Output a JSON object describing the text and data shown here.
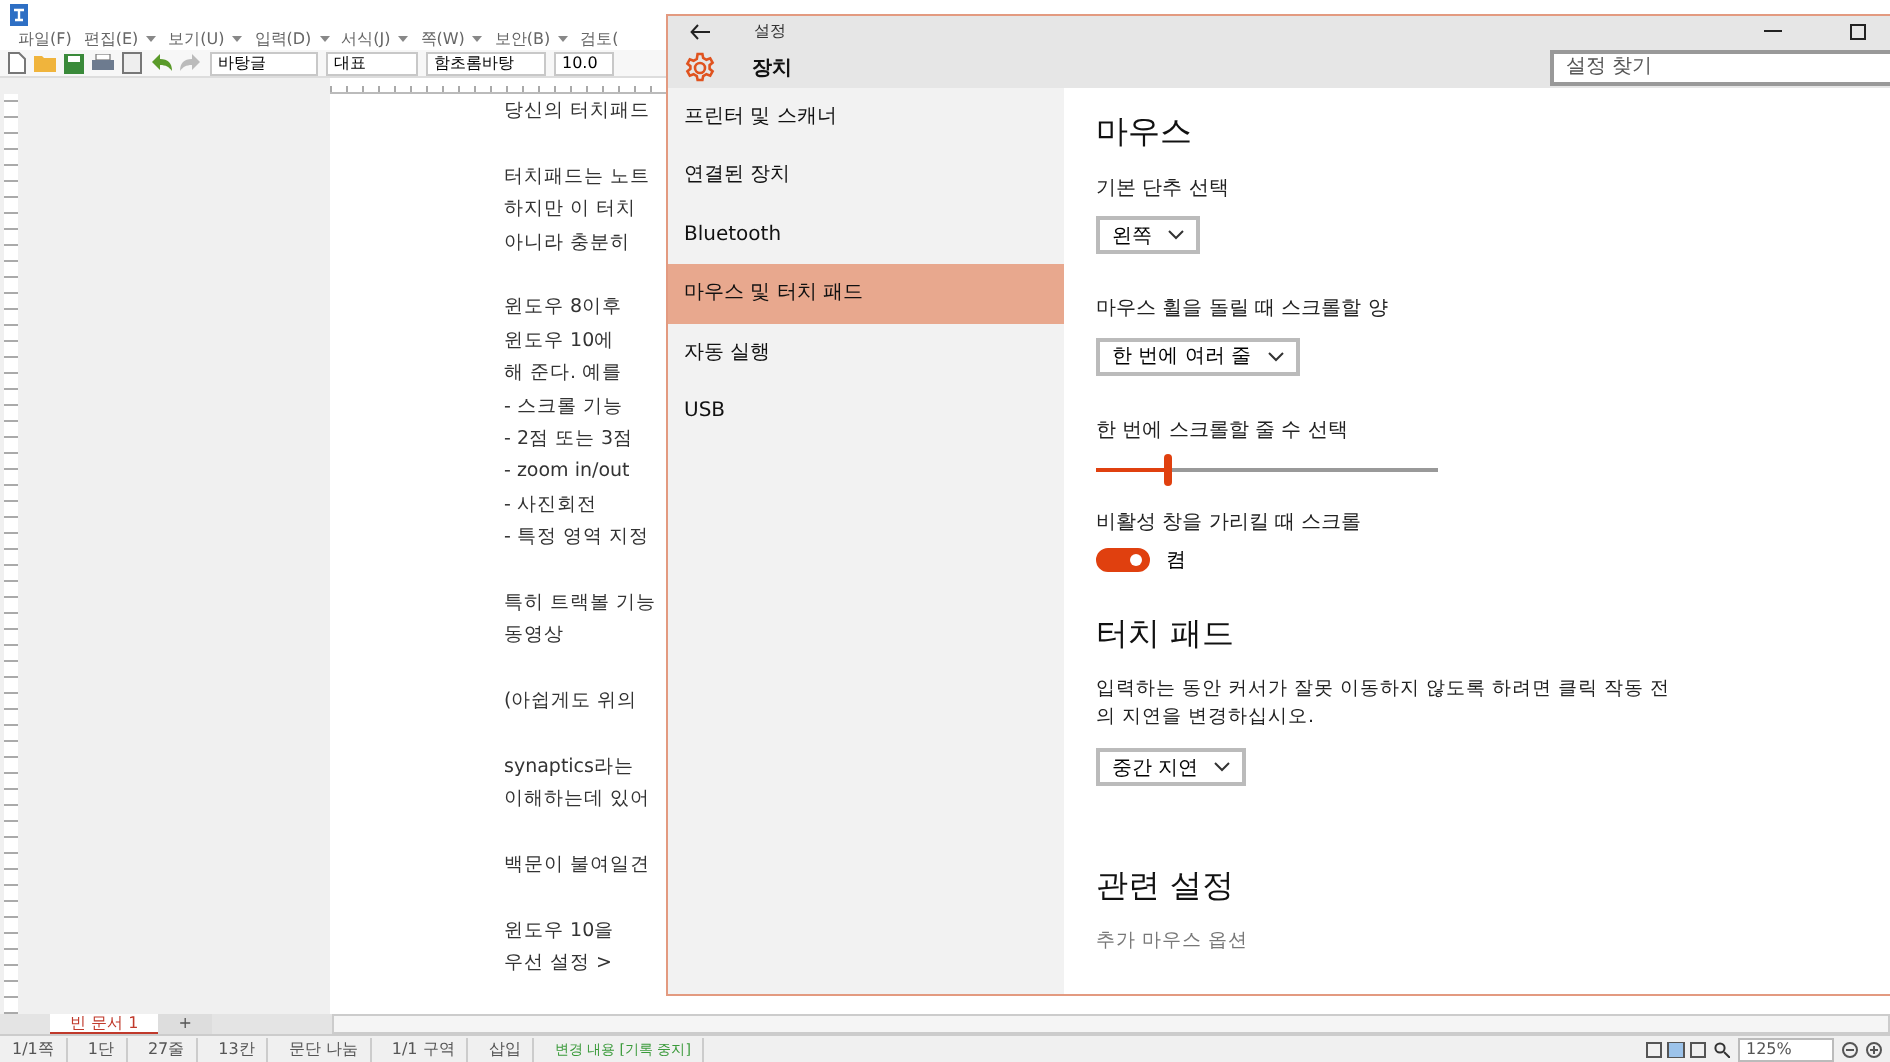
{
  "editor": {
    "menu": [
      "파일(F)",
      "편집(E)",
      "보기(U)",
      "입력(D)",
      "서식(J)",
      "쪽(W)",
      "보안(B)",
      "검토("
    ],
    "toolbar": {
      "style": "바탕글",
      "outline": "대표",
      "font": "함초롬바탕",
      "size": "10.0"
    },
    "paragraphs": [
      [
        "당신의 터치패드"
      ],
      [
        "터치패드는 노트",
        "하지만 이 터치",
        "아니라 충분히"
      ],
      [
        "윈도우 8이후",
        "윈도우 10에",
        "해 준다. 예를",
        "- 스크롤 기능",
        "- 2점 또는 3점",
        "- zoom in/out",
        "- 사진회전",
        "- 특정 영역 지정"
      ],
      [
        "특히 트랙볼 기능",
        "동영상"
      ],
      [
        "(아쉽게도 위의"
      ],
      [
        "synaptics라는",
        "이해하는데 있어"
      ],
      [
        "백문이 불여일견"
      ],
      [
        "윈도우 10을",
        "우선 설정 >"
      ]
    ],
    "doc_tabs": [
      {
        "label": "빈 문서 1",
        "selected": true
      },
      {
        "label": "+",
        "selected": false
      }
    ],
    "status_bar": [
      "1/1쪽",
      "1단",
      "27줄",
      "13칸",
      "문단 나눔",
      "1/1 구역",
      "삽입"
    ],
    "track_changes": "변경 내용 [기록 중지]",
    "zoom": "125%"
  },
  "settings": {
    "window_title": "설정",
    "header": "장치",
    "search": {
      "placeholder": "설정 찾기"
    },
    "sidebar": [
      {
        "label": "프린터 및 스캐너",
        "selected": false
      },
      {
        "label": "연결된 장치",
        "selected": false
      },
      {
        "label": "Bluetooth",
        "selected": false
      },
      {
        "label": "마우스 및 터치 패드",
        "selected": true
      },
      {
        "label": "자동 실행",
        "selected": false
      },
      {
        "label": "USB",
        "selected": false
      }
    ],
    "sections": [
      {
        "title": "마우스",
        "items": [
          {
            "kind": "dropdown",
            "label": "기본 단추 선택",
            "value": "왼쪽"
          },
          {
            "kind": "dropdown",
            "label": "마우스 휠을 돌릴 때 스크롤할 양",
            "value": "한 번에 여러 줄"
          },
          {
            "kind": "slider",
            "label": "한 번에 스크롤할 줄 수 선택",
            "level": 0.21
          },
          {
            "kind": "toggle",
            "label": "비활성 창을 가리킬 때 스크롤",
            "on": true,
            "state": "켬"
          }
        ]
      },
      {
        "title": "터치 패드",
        "items": [
          {
            "kind": "text",
            "label": "입력하는 동안 커서가 잘못 이동하지 않도록 하려면 클릭 작동 전의 지연을 변경하십시오."
          },
          {
            "kind": "dropdown",
            "value": "중간 지연"
          }
        ]
      },
      {
        "title": "관련 설정",
        "items": [
          {
            "kind": "link",
            "label": "추가 마우스 옵션"
          }
        ]
      }
    ]
  }
}
